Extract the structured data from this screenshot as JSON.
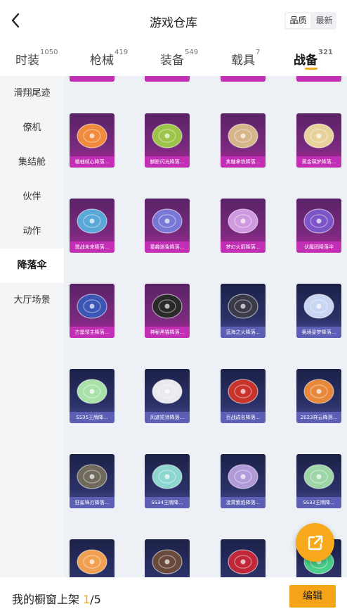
{
  "header": {
    "title": "游戏仓库",
    "sort_options": [
      "品质",
      "最新"
    ]
  },
  "tabs": [
    {
      "label": "时装",
      "count": "1050"
    },
    {
      "label": "枪械",
      "count": "419"
    },
    {
      "label": "装备",
      "count": "549"
    },
    {
      "label": "载具",
      "count": "7"
    },
    {
      "label": "战备",
      "count": "321"
    }
  ],
  "sidebar": {
    "items": [
      {
        "label": "滑翔尾迹"
      },
      {
        "label": "僚机"
      },
      {
        "label": "集结舱"
      },
      {
        "label": "伙伴"
      },
      {
        "label": "动作"
      },
      {
        "label": "降落伞"
      },
      {
        "label": "大厅场景"
      }
    ]
  },
  "items": [
    {
      "name": "橘柚倾心降落...",
      "rarity": "purple",
      "color": "#f08a3c"
    },
    {
      "name": "麒影闪光降落...",
      "rarity": "purple",
      "color": "#9ec44a"
    },
    {
      "name": "焦糖拿铁降落...",
      "rarity": "purple",
      "color": "#d7b58a"
    },
    {
      "name": "黄金璃梦降落...",
      "rarity": "purple",
      "color": "#e8d29a"
    },
    {
      "name": "激战未来降落...",
      "rarity": "purple",
      "color": "#5aa8d8"
    },
    {
      "name": "童趣迷兔降落...",
      "rarity": "purple",
      "color": "#7a78d6"
    },
    {
      "name": "梦幻火箭降落...",
      "rarity": "purple",
      "color": "#d09ae0"
    },
    {
      "name": "伏魔团降落伞",
      "rarity": "purple",
      "color": "#7d55c8"
    },
    {
      "name": "古堡领主降落...",
      "rarity": "purple",
      "color": "#3b56b5"
    },
    {
      "name": "神秘黑猫降落...",
      "rarity": "purple",
      "color": "#2a2a2a"
    },
    {
      "name": "蓝海之火降落...",
      "rarity": "blue",
      "color": "#3a3a48"
    },
    {
      "name": "奥境星梦降落...",
      "rarity": "blue",
      "color": "#c9d6f2"
    },
    {
      "name": "SS35王牌降...",
      "rarity": "blue",
      "color": "#a9e2a8"
    },
    {
      "name": "风迹短诗降落...",
      "rarity": "blue",
      "color": "#e9e9ef"
    },
    {
      "name": "百战成名降落...",
      "rarity": "blue",
      "color": "#c8342c"
    },
    {
      "name": "2023祥云降落...",
      "rarity": "blue",
      "color": "#e8883a"
    },
    {
      "name": "狂鲨锋刃降落...",
      "rarity": "blue",
      "color": "#6f6a5c"
    },
    {
      "name": "SS34王牌降...",
      "rarity": "blue",
      "color": "#8ed6d0"
    },
    {
      "name": "凌霄紫焰降落...",
      "rarity": "blue",
      "color": "#b09ad8"
    },
    {
      "name": "SS33王牌降...",
      "rarity": "blue",
      "color": "#9ed6a8"
    },
    {
      "name": "",
      "rarity": "blue",
      "color": "#f0a050"
    },
    {
      "name": "",
      "rarity": "blue",
      "color": "#6a4a3a"
    },
    {
      "name": "",
      "rarity": "blue",
      "color": "#c0283a"
    },
    {
      "name": "",
      "rarity": "blue",
      "color": "#4ad08a"
    }
  ],
  "bottom": {
    "label": "我的橱窗上架 ",
    "current": "1",
    "total": "/5",
    "edit_label": "编辑"
  },
  "colors": {
    "accent": "#f6a417",
    "purple_rarity": "#c22eb4",
    "blue_rarity": "#5d5fb4"
  },
  "icons": {
    "back": "chevron-left-icon",
    "share": "external-link-icon",
    "item_image": "parachute-icon"
  }
}
